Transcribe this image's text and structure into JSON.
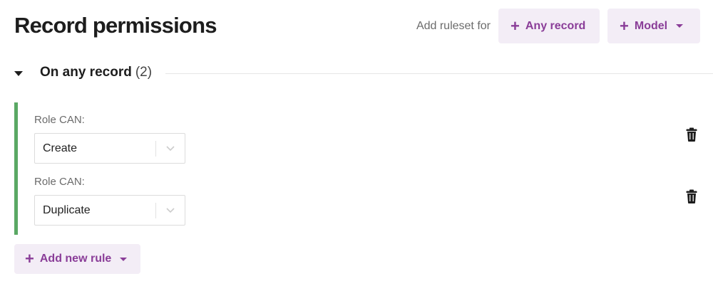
{
  "page": {
    "title": "Record permissions"
  },
  "header": {
    "add_ruleset_label": "Add ruleset for",
    "any_record_button": "Any record",
    "model_button": "Model"
  },
  "section": {
    "title": "On any record",
    "count": "(2)"
  },
  "rules": [
    {
      "label": "Role CAN:",
      "value": "Create"
    },
    {
      "label": "Role CAN:",
      "value": "Duplicate"
    }
  ],
  "add_rule_button": "Add new rule",
  "colors": {
    "accent": "#8a3d98",
    "button_bg": "#f3edf6",
    "ruleset_border": "#5aa864"
  }
}
